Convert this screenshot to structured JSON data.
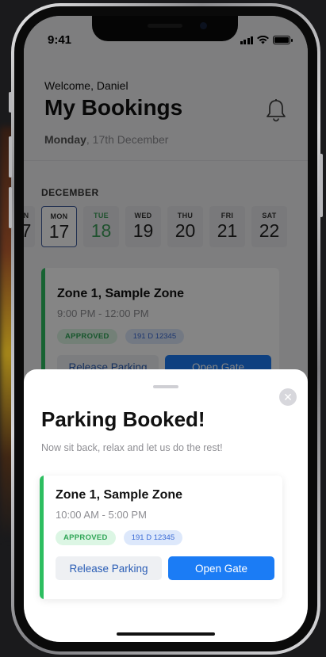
{
  "status_bar": {
    "time": "9:41"
  },
  "header": {
    "welcome": "Welcome, Daniel",
    "title": "My Bookings",
    "date_day": "Monday",
    "date_rest": ", 17th December"
  },
  "calendar": {
    "month": "DECEMBER",
    "partial_day": {
      "name": "N",
      "num": "7"
    },
    "days": [
      {
        "name": "MON",
        "num": "17"
      },
      {
        "name": "TUE",
        "num": "18"
      },
      {
        "name": "WED",
        "num": "19"
      },
      {
        "name": "THU",
        "num": "20"
      },
      {
        "name": "FRI",
        "num": "21"
      },
      {
        "name": "SAT",
        "num": "22"
      }
    ]
  },
  "booking_card": {
    "zone": "Zone 1, Sample Zone",
    "time": "9:00 PM - 12:00 PM",
    "status": "APPROVED",
    "plate": "191 D 12345",
    "release_label": "Release Parking",
    "gate_label": "Open Gate"
  },
  "sheet": {
    "title": "Parking Booked!",
    "subtitle": "Now sit back, relax and let us do the rest!",
    "close_glyph": "✕",
    "card": {
      "zone": "Zone 1, Sample Zone",
      "time": "10:00 AM - 5:00 PM",
      "status": "APPROVED",
      "plate": "191 D 12345",
      "release_label": "Release Parking",
      "gate_label": "Open Gate"
    }
  },
  "colors": {
    "accent_green": "#2dbe60",
    "primary_blue": "#1b7cf5",
    "selected_border": "#3e5a99"
  }
}
